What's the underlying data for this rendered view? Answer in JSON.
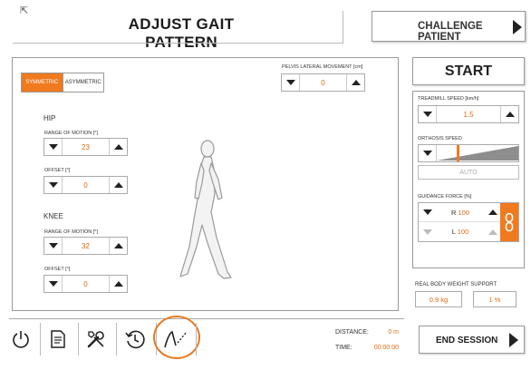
{
  "header": {
    "title": "ADJUST GAIT PATTERN",
    "challenge_label": "CHALLENGE PATIENT"
  },
  "symmetry": {
    "symmetric_label": "SYMMETRIC",
    "asymmetric_label": "ASYMMETRIC",
    "selected": "SYMMETRIC"
  },
  "pelvis": {
    "label": "PELVIS LATERAL MOVEMENT [cm]",
    "value": "0"
  },
  "hip": {
    "title": "HIP",
    "rom_label": "RANGE OF MOTION [°]",
    "rom_value": "23",
    "offset_label": "OFFSET [°]",
    "offset_value": "0"
  },
  "knee": {
    "title": "KNEE",
    "rom_label": "RANGE OF MOTION [°]",
    "rom_value": "32",
    "offset_label": "OFFSET [°]",
    "offset_value": "0"
  },
  "start_label": "START",
  "treadmill": {
    "label": "TREADMILL SPEED [km/h]",
    "value": "1.5"
  },
  "orthosis": {
    "label": "ORTHOSIS SPEED",
    "auto_label": "AUTO"
  },
  "guidance": {
    "label": "GUIDANCE FORCE [%]",
    "right_prefix": "R",
    "right_value": "100",
    "left_prefix": "L",
    "left_value": "100"
  },
  "rbws": {
    "label": "REAL BODY WEIGHT SUPPORT",
    "kg_value": "0.9 kg",
    "pct_value": "1 %"
  },
  "stats": {
    "distance_label": "DISTANCE:",
    "distance_value": "0 m",
    "time_label": "TIME:",
    "time_value": "00:00:00"
  },
  "end_session_label": "END SESSION",
  "colors": {
    "accent": "#f07a1e",
    "value_text": "#e06a10"
  },
  "icons": [
    "power-icon",
    "document-icon",
    "tools-icon",
    "history-icon",
    "gait-curve-icon",
    "link-icon",
    "walking-figure"
  ]
}
